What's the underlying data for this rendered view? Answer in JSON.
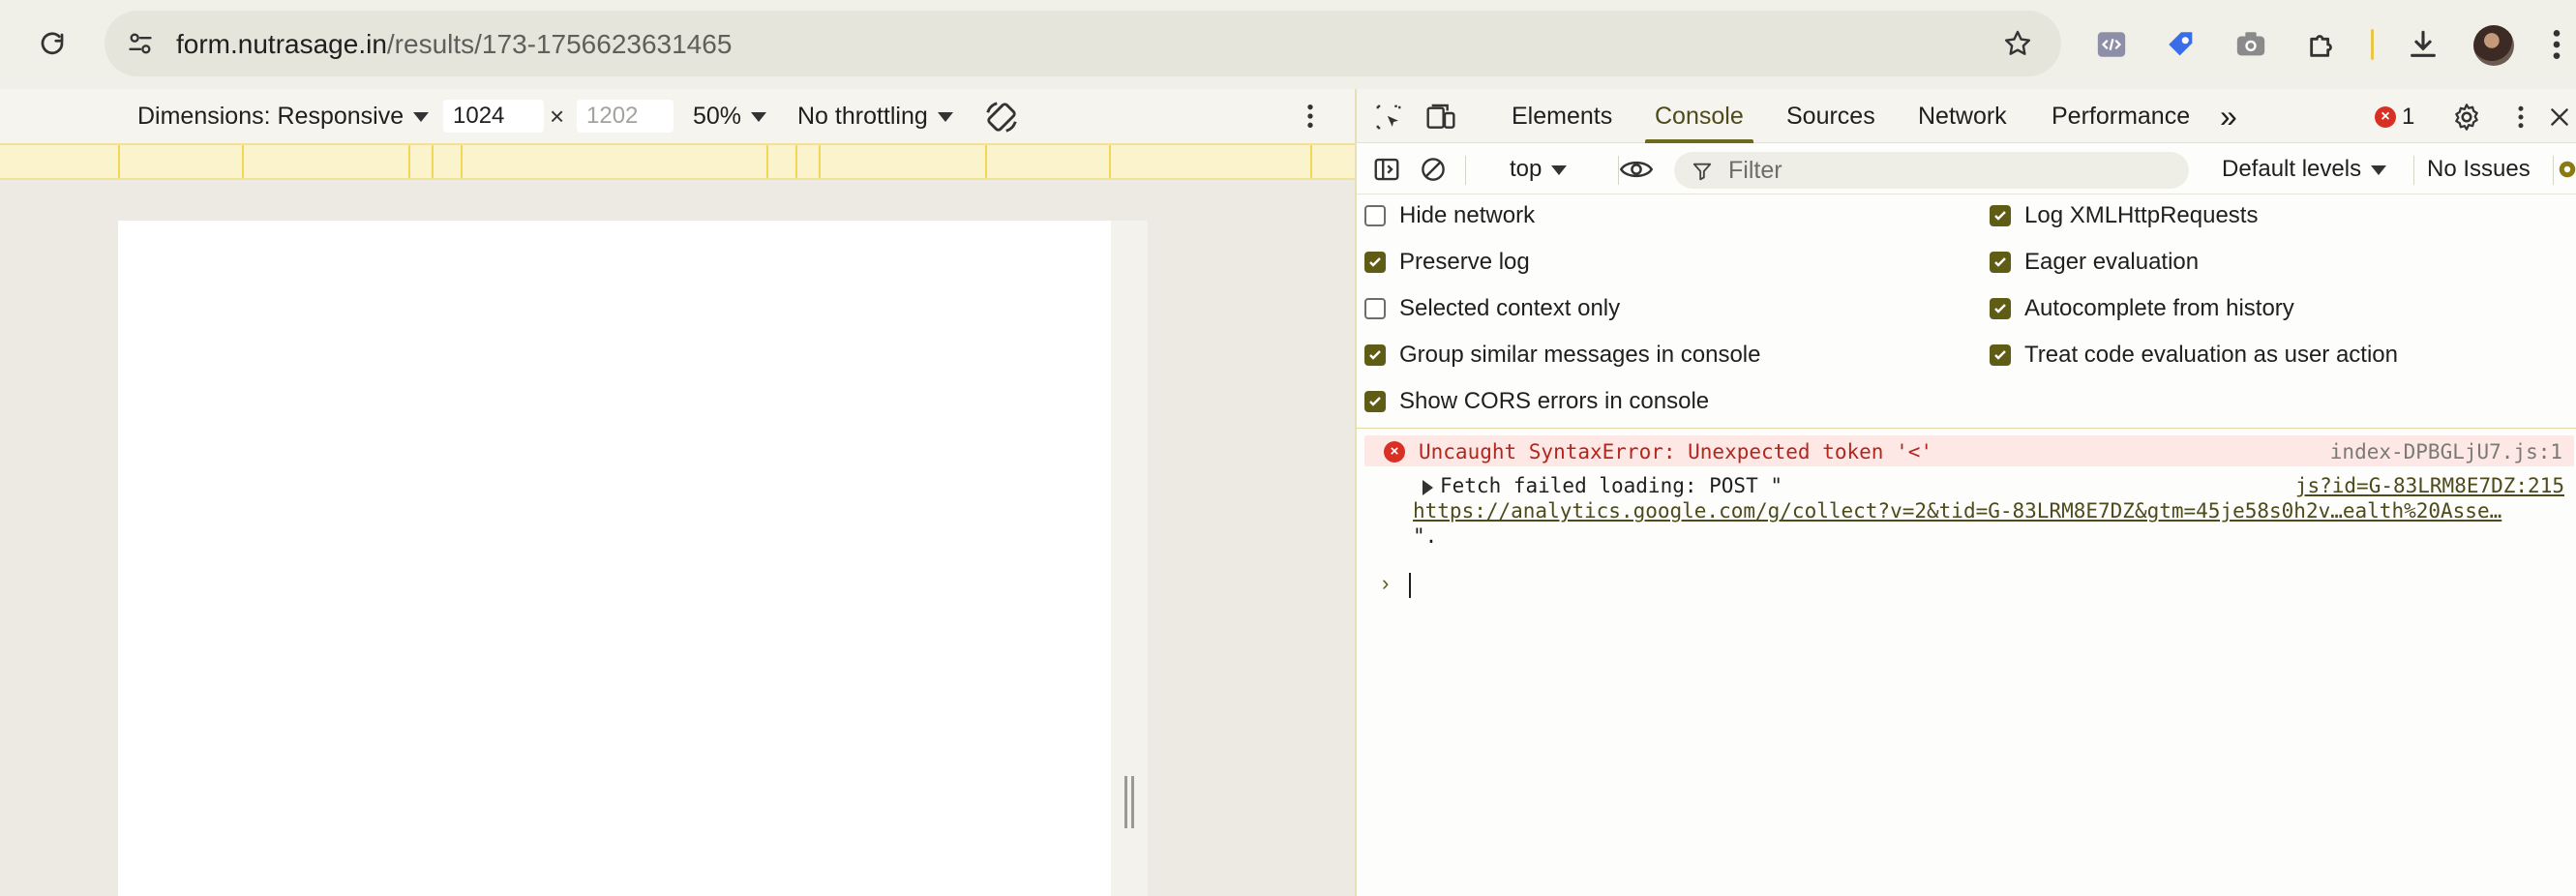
{
  "browser": {
    "url_host": "form.nutrasage.in",
    "url_path": "/results/173-1756623631465",
    "icons": [
      "reload-icon",
      "site-info-icon",
      "bookmark-star-icon",
      "code-extension-icon",
      "tag-extension-icon",
      "camera-extension-icon",
      "puzzle-extensions-icon",
      "download-icon",
      "avatar",
      "menu-kebab-icon"
    ]
  },
  "device_toolbar": {
    "dimensions_label": "Dimensions: Responsive",
    "width_value": "1024",
    "times": "×",
    "height_placeholder": "1202",
    "zoom": "50%",
    "throttling": "No throttling"
  },
  "devtools": {
    "tabs": [
      "Elements",
      "Console",
      "Sources",
      "Network",
      "Performance"
    ],
    "active_tab": "Console",
    "overflow": "»",
    "error_count": "1",
    "context": "top",
    "filter_placeholder": "Filter",
    "levels": "Default levels",
    "issues": "No Issues",
    "settings": {
      "left": [
        {
          "label": "Hide network",
          "checked": false
        },
        {
          "label": "Preserve log",
          "checked": true
        },
        {
          "label": "Selected context only",
          "checked": false
        },
        {
          "label": "Group similar messages in console",
          "checked": true
        },
        {
          "label": "Show CORS errors in console",
          "checked": true
        }
      ],
      "right": [
        {
          "label": "Log XMLHttpRequests",
          "checked": true
        },
        {
          "label": "Eager evaluation",
          "checked": true
        },
        {
          "label": "Autocomplete from history",
          "checked": true
        },
        {
          "label": "Treat code evaluation as user action",
          "checked": true
        }
      ]
    },
    "messages": {
      "error_text": "Uncaught SyntaxError: Unexpected token '<'",
      "error_source": "index-DPBGLjU7.js:1",
      "fetch_text": "Fetch failed loading: POST \"",
      "fetch_source": "js?id=G-83LRM8E7DZ:215",
      "fetch_url": "https://analytics.google.com/g/collect?v=2&tid=G-83LRM8E7DZ&gtm=45je58s0h2v…ealth%20Asse…",
      "fetch_tail": "\"."
    },
    "prompt_symbol": "›",
    "colors": {
      "accent": "#5f5c16",
      "error": "#d93025",
      "error_bg": "#fde8e6",
      "ruler": "#fbf3cc"
    }
  }
}
